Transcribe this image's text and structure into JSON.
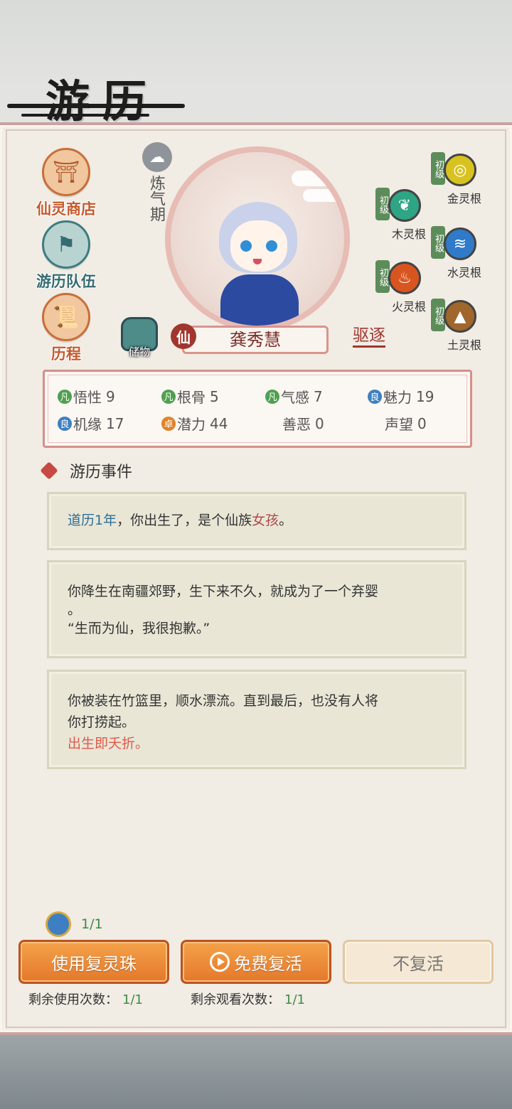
{
  "header": {
    "title": "游历"
  },
  "side_menu": [
    {
      "label": "仙灵商店",
      "icon": "shop-icon"
    },
    {
      "label": "游历队伍",
      "icon": "flag-icon"
    },
    {
      "label": "历程",
      "icon": "scroll-icon"
    }
  ],
  "character": {
    "realm": "炼气期",
    "storage_label": "储物",
    "race_badge": "仙",
    "name": "龚秀慧",
    "expel_label": "驱逐"
  },
  "spirit_roots": [
    {
      "level": "初级",
      "name": "金灵根",
      "color": "#d8c21f"
    },
    {
      "level": "初级",
      "name": "木灵根",
      "color": "#2ea585"
    },
    {
      "level": "初级",
      "name": "水灵根",
      "color": "#2f7bc9"
    },
    {
      "level": "初级",
      "name": "火灵根",
      "color": "#d9551f"
    },
    {
      "level": "初级",
      "name": "土灵根",
      "color": "#a0662b"
    }
  ],
  "stats": [
    {
      "grade": "凡",
      "name": "悟性",
      "value": "9",
      "grade_color": "#4fa04f"
    },
    {
      "grade": "凡",
      "name": "根骨",
      "value": "5",
      "grade_color": "#4fa04f"
    },
    {
      "grade": "凡",
      "name": "气感",
      "value": "7",
      "grade_color": "#4fa04f"
    },
    {
      "grade": "良",
      "name": "魅力",
      "value": "19",
      "grade_color": "#3d7fc1"
    },
    {
      "grade": "良",
      "name": "机缘",
      "value": "17",
      "grade_color": "#3d7fc1"
    },
    {
      "grade": "卓",
      "name": "潜力",
      "value": "44",
      "grade_color": "#e0822a"
    },
    {
      "grade": "",
      "name": "善恶",
      "value": "0",
      "grade_color": ""
    },
    {
      "grade": "",
      "name": "声望",
      "value": "0",
      "grade_color": ""
    }
  ],
  "events": {
    "heading": "游历事件",
    "e1": {
      "part1": "道历1年",
      "part2": "，你出生了，是个仙族",
      "part3": "女孩",
      "part4": "。"
    },
    "e2": {
      "line1": "你降生在南疆郊野，生下来不久，就成为了一个弃婴",
      "line2": "。",
      "line3": "“生而为仙，我很抱歉。”"
    },
    "e3": {
      "line1": "你被装在竹篮里，顺水漂流。直到最后，也没有人将",
      "line2": "你打捞起。",
      "line3": "出生即夭折。"
    }
  },
  "bottom": {
    "pearl_count": "1/1",
    "btn_use": "使用复灵珠",
    "btn_free": "免费复活",
    "btn_no": "不复活",
    "remain_use_label": "剩余使用次数：",
    "remain_use_value": "1/1",
    "remain_watch_label": "剩余观看次数：",
    "remain_watch_value": "1/1"
  }
}
